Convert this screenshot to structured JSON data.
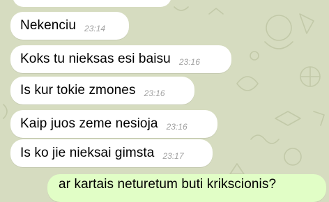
{
  "conversation": {
    "wallpaper_color": "#d6dcc0",
    "incoming_bubble_color": "#ffffff",
    "outgoing_bubble_color": "#e1fec6",
    "messages": [
      {
        "text": "Nekenciu",
        "time": "23:14",
        "direction": "incoming"
      },
      {
        "text": "Koks tu nieksas esi baisu",
        "time": "23:16",
        "direction": "incoming"
      },
      {
        "text": "Is kur tokie zmones",
        "time": "23:16",
        "direction": "incoming"
      },
      {
        "text": "Kaip juos zeme nesioja",
        "time": "23:16",
        "direction": "incoming"
      },
      {
        "text": "Is ko jie nieksai gimsta",
        "time": "23:17",
        "direction": "incoming"
      },
      {
        "text": "ar kartais neturetum buti krikscionis?",
        "time": "",
        "direction": "outgoing"
      }
    ]
  }
}
